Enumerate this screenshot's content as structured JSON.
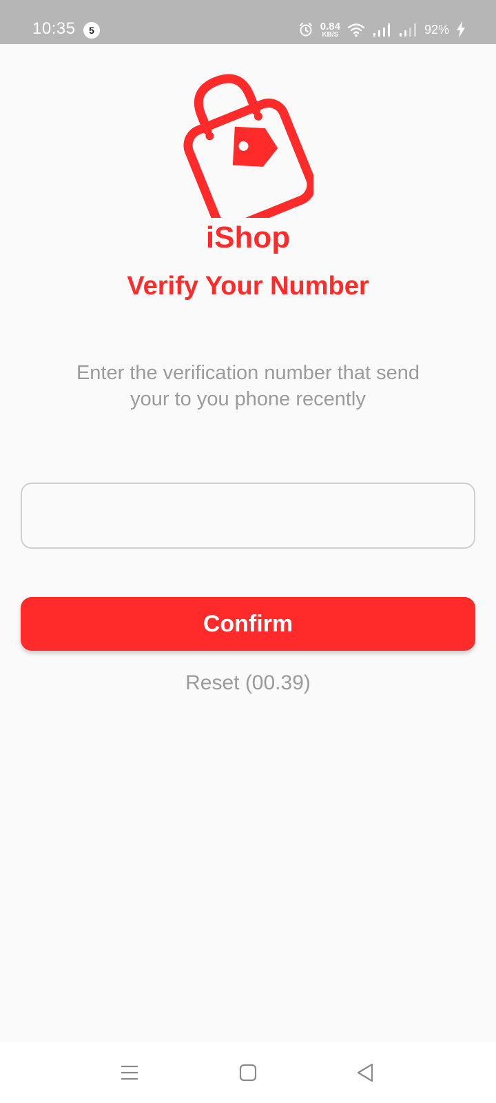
{
  "status_bar": {
    "time": "10:35",
    "notification_count": "5",
    "net_speed_value": "0.84",
    "net_speed_unit": "KB/S",
    "battery": "92%"
  },
  "app": {
    "name": "iShop",
    "brand_color": "#ff2a2a"
  },
  "verify": {
    "title": "Verify Your Number",
    "instruction_line1": "Enter the verification number that send",
    "instruction_line2": "your to you phone recently",
    "code_value": "",
    "confirm_label": "Confirm",
    "reset_label": "Reset (00.39)"
  },
  "icons": {
    "logo": "shopping-bag-tag-icon",
    "status": [
      "alarm-icon",
      "wifi-icon",
      "signal-icon",
      "signal-weak-icon",
      "charging-bolt-icon"
    ],
    "nav": [
      "menu-icon",
      "home-square-icon",
      "back-triangle-icon"
    ]
  }
}
